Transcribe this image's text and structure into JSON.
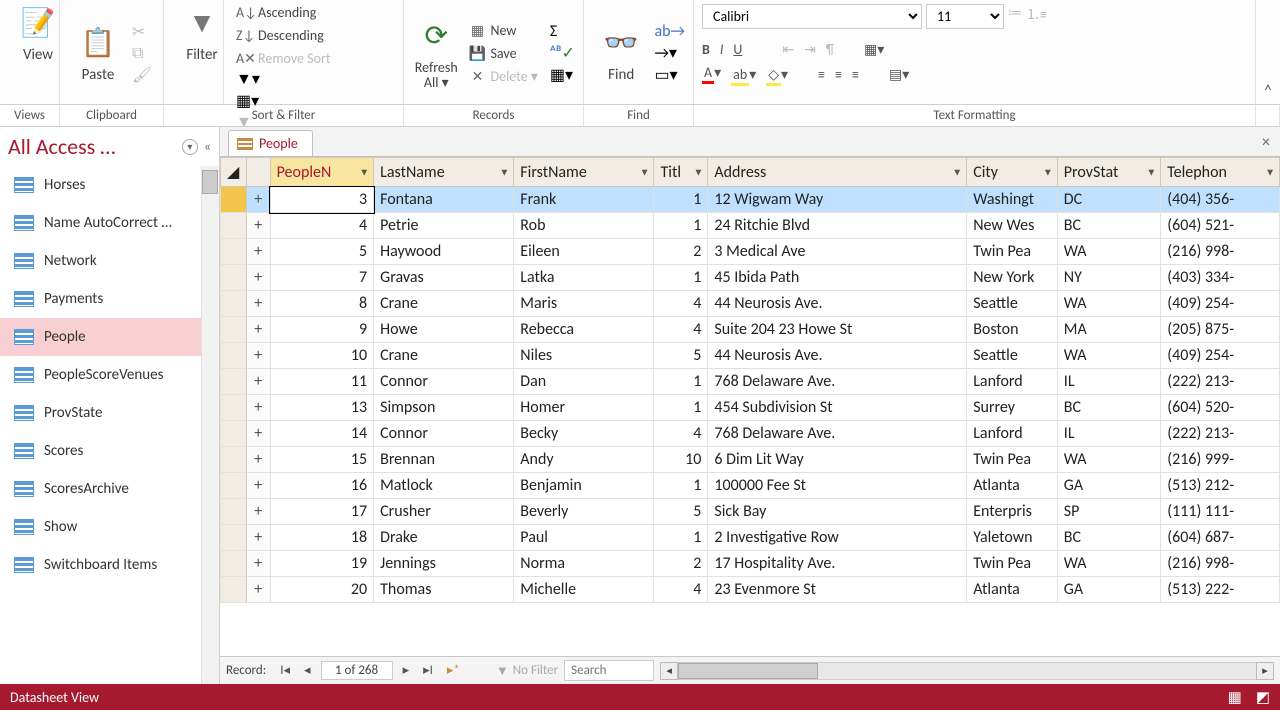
{
  "ribbon": {
    "view": "View",
    "paste": "Paste",
    "filter": "Filter",
    "ascending": "Ascending",
    "descending": "Descending",
    "remove_sort": "Remove Sort",
    "refresh": "Refresh All ▾",
    "new": "New",
    "save": "Save",
    "delete": "Delete ▾",
    "find": "Find",
    "font_name": "Calibri",
    "font_size": "11",
    "groups": {
      "views": "Views",
      "clipboard": "Clipboard",
      "sort_filter": "Sort & Filter",
      "records": "Records",
      "find": "Find",
      "text_formatting": "Text Formatting"
    }
  },
  "nav": {
    "title": "All Access …",
    "items": [
      "Horses",
      "Name AutoCorrect …",
      "Network",
      "Payments",
      "People",
      "PeopleScoreVenues",
      "ProvState",
      "Scores",
      "ScoresArchive",
      "Show",
      "Switchboard Items"
    ],
    "selected": "People"
  },
  "tab": {
    "label": "People"
  },
  "columns": [
    "PeopleN",
    "LastName",
    "FirstName",
    "Titl",
    "Address",
    "City",
    "ProvStat",
    "Telephon"
  ],
  "editing_value": "3",
  "rows": [
    {
      "n": "3",
      "last": "Fontana",
      "first": "Frank",
      "t": "1",
      "addr": "12 Wigwam Way",
      "city": "Washingt",
      "prov": "DC",
      "tel": "(404) 356-"
    },
    {
      "n": "4",
      "last": "Petrie",
      "first": "Rob",
      "t": "1",
      "addr": "24 Ritchie Blvd",
      "city": "New Wes",
      "prov": "BC",
      "tel": "(604) 521-"
    },
    {
      "n": "5",
      "last": "Haywood",
      "first": "Eileen",
      "t": "2",
      "addr": "3 Medical Ave",
      "city": "Twin Pea",
      "prov": "WA",
      "tel": "(216) 998-"
    },
    {
      "n": "7",
      "last": "Gravas",
      "first": "Latka",
      "t": "1",
      "addr": "45 Ibida Path",
      "city": "New York",
      "prov": "NY",
      "tel": "(403) 334-"
    },
    {
      "n": "8",
      "last": "Crane",
      "first": "Maris",
      "t": "4",
      "addr": "44 Neurosis Ave.",
      "city": "Seattle",
      "prov": "WA",
      "tel": "(409) 254-"
    },
    {
      "n": "9",
      "last": "Howe",
      "first": "Rebecca",
      "t": "4",
      "addr": "Suite 204 23 Howe St",
      "city": "Boston",
      "prov": "MA",
      "tel": "(205) 875-"
    },
    {
      "n": "10",
      "last": "Crane",
      "first": "Niles",
      "t": "5",
      "addr": "44 Neurosis Ave.",
      "city": "Seattle",
      "prov": "WA",
      "tel": "(409) 254-"
    },
    {
      "n": "11",
      "last": "Connor",
      "first": "Dan",
      "t": "1",
      "addr": "768 Delaware Ave.",
      "city": "Lanford",
      "prov": "IL",
      "tel": "(222) 213-"
    },
    {
      "n": "13",
      "last": "Simpson",
      "first": "Homer",
      "t": "1",
      "addr": "454 Subdivision St",
      "city": "Surrey",
      "prov": "BC",
      "tel": "(604) 520-"
    },
    {
      "n": "14",
      "last": "Connor",
      "first": "Becky",
      "t": "4",
      "addr": "768 Delaware Ave.",
      "city": "Lanford",
      "prov": "IL",
      "tel": "(222) 213-"
    },
    {
      "n": "15",
      "last": "Brennan",
      "first": "Andy",
      "t": "10",
      "addr": "6 Dim Lit Way",
      "city": "Twin Pea",
      "prov": "WA",
      "tel": "(216) 999-"
    },
    {
      "n": "16",
      "last": "Matlock",
      "first": "Benjamin",
      "t": "1",
      "addr": "100000 Fee St",
      "city": "Atlanta",
      "prov": "GA",
      "tel": "(513) 212-"
    },
    {
      "n": "17",
      "last": "Crusher",
      "first": "Beverly",
      "t": "5",
      "addr": "Sick Bay",
      "city": "Enterpris",
      "prov": "SP",
      "tel": "(111) 111-"
    },
    {
      "n": "18",
      "last": "Drake",
      "first": "Paul",
      "t": "1",
      "addr": "2 Investigative Row",
      "city": "Yaletown",
      "prov": "BC",
      "tel": "(604) 687-"
    },
    {
      "n": "19",
      "last": "Jennings",
      "first": "Norma",
      "t": "2",
      "addr": "17 Hospitality Ave.",
      "city": "Twin Pea",
      "prov": "WA",
      "tel": "(216) 998-"
    },
    {
      "n": "20",
      "last": "Thomas",
      "first": "Michelle",
      "t": "4",
      "addr": "23 Evenmore St",
      "city": "Atlanta",
      "prov": "GA",
      "tel": "(513) 222-"
    }
  ],
  "recnav": {
    "label": "Record:",
    "counter": "1 of 268",
    "filter": "No Filter",
    "search_placeholder": "Search"
  },
  "status": {
    "view": "Datasheet View"
  }
}
